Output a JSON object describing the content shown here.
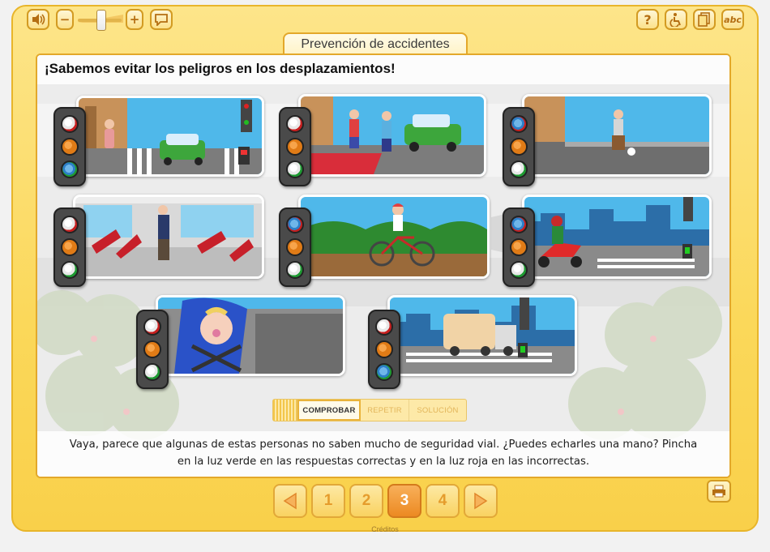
{
  "toolbar": {
    "left": [
      "speaker-icon",
      "minus-icon",
      "volume-slider",
      "plus-icon",
      "speech-bubble-icon"
    ],
    "right": [
      {
        "icon": "help-icon",
        "label": "?"
      },
      {
        "icon": "accessibility-icon",
        "label": ""
      },
      {
        "icon": "pages-icon",
        "label": ""
      },
      {
        "icon": "spelling-icon",
        "label": "abc"
      }
    ],
    "volume_level": 0.45,
    "minus_label": "−",
    "plus_label": "+"
  },
  "activity": {
    "tab_title": "Prevención de accidentes",
    "heading": "¡Sabemos evitar los peligros en los desplazamientos!"
  },
  "scenes": [
    {
      "name": "elderly-crossing-red",
      "red_on": false,
      "green_on": true
    },
    {
      "name": "kids-running-road",
      "red_on": false,
      "green_on": false
    },
    {
      "name": "boy-ball-street",
      "red_on": true,
      "green_on": false
    },
    {
      "name": "bus-standing",
      "red_on": false,
      "green_on": false
    },
    {
      "name": "cyclist-helmet",
      "red_on": true,
      "green_on": false
    },
    {
      "name": "motorcyclist-helmet",
      "red_on": true,
      "green_on": false
    },
    {
      "name": "baby-car-seat",
      "red_on": false,
      "green_on": false
    },
    {
      "name": "truck-crossing",
      "red_on": false,
      "green_on": true
    }
  ],
  "controls": {
    "check": "COMPROBAR",
    "repeat": "REPETIR",
    "solution": "SOLUCIÓN"
  },
  "instructions": {
    "line1": "Vaya, parece que algunas de estas personas no saben mucho de seguridad vial. ¿Puedes echarles una mano? Pincha",
    "line2": "en la luz verde en las respuestas correctas y en la luz roja en las incorrectas."
  },
  "pagination": {
    "pages": [
      "1",
      "2",
      "3",
      "4"
    ],
    "current": "3"
  },
  "footer": {
    "credits": "Créditos"
  },
  "colors": {
    "frame": "#fbd85a",
    "accent_orange": "#ec8a22",
    "traffic_red": "#c71f1f",
    "traffic_green": "#1e9a32",
    "lamp_selected": "#2d7fc8"
  }
}
